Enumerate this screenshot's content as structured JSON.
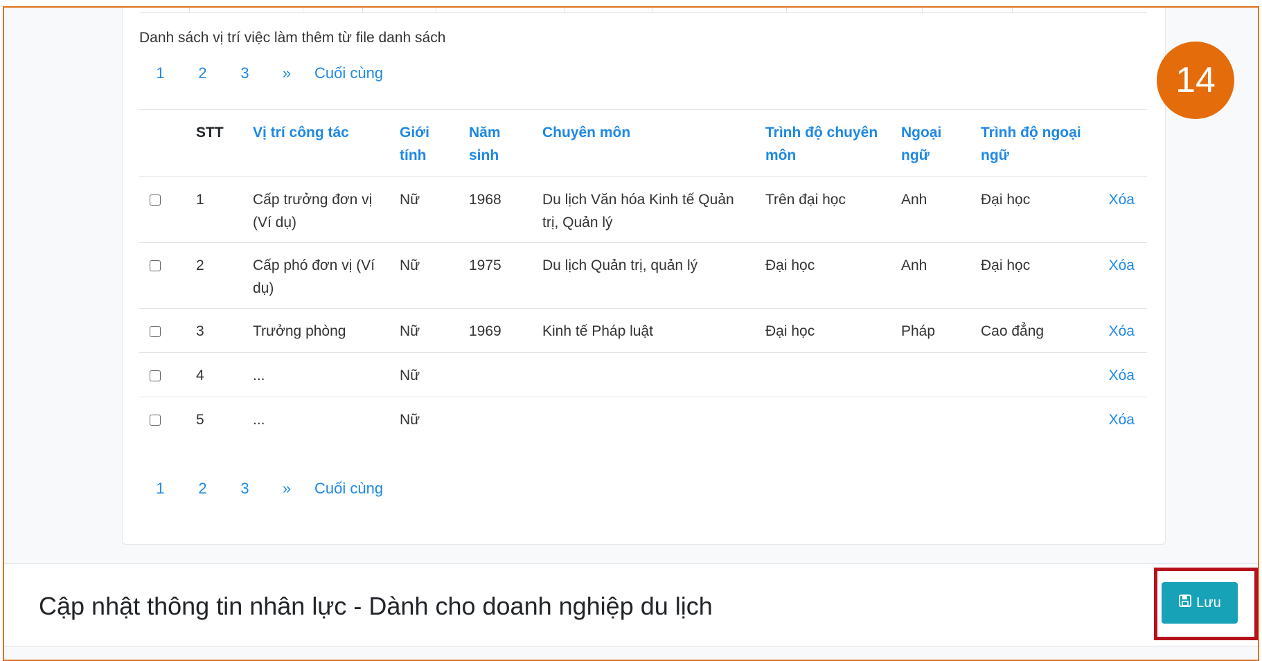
{
  "list_caption": "Danh sách vị trí việc làm thêm từ file danh sách",
  "pagination": {
    "pages": [
      "1",
      "2",
      "3"
    ],
    "next": "»",
    "last": "Cuối cùng"
  },
  "table": {
    "headers": {
      "stt": "STT",
      "position": "Vị trí công tác",
      "gender": "Giới tính",
      "birth_year": "Năm sinh",
      "specialty": "Chuyên môn",
      "qualification": "Trình độ chuyên môn",
      "language": "Ngoại ngữ",
      "language_level": "Trình độ ngoại ngữ"
    },
    "rows": [
      {
        "stt": "1",
        "position": "Cấp trưởng đơn vị (Ví dụ)",
        "gender": "Nữ",
        "birth_year": "1968",
        "specialty": "Du lịch Văn hóa Kinh tế Quản trị, Quản lý",
        "qualification": "Trên đại học",
        "language": "Anh",
        "language_level": "Đại học",
        "action": "Xóa"
      },
      {
        "stt": "2",
        "position": "Cấp phó đơn vị (Ví dụ)",
        "gender": "Nữ",
        "birth_year": "1975",
        "specialty": "Du lịch Quản trị, quản lý",
        "qualification": "Đại học",
        "language": "Anh",
        "language_level": "Đại học",
        "action": "Xóa"
      },
      {
        "stt": "3",
        "position": "Trưởng phòng",
        "gender": "Nữ",
        "birth_year": "1969",
        "specialty": "Kinh tế Pháp luật",
        "qualification": "Đại học",
        "language": "Pháp",
        "language_level": "Cao đẳng",
        "action": "Xóa"
      },
      {
        "stt": "4",
        "position": "...",
        "gender": "Nữ",
        "birth_year": "",
        "specialty": "",
        "qualification": "",
        "language": "",
        "language_level": "",
        "action": "Xóa"
      },
      {
        "stt": "5",
        "position": "...",
        "gender": "Nữ",
        "birth_year": "",
        "specialty": "",
        "qualification": "",
        "language": "",
        "language_level": "",
        "action": "Xóa"
      }
    ]
  },
  "step_badge": "14",
  "footer": {
    "title": "Cập nhật thông tin nhân lực - Dành cho doanh nghiệp du lịch",
    "save_label": "Lưu",
    "save_icon": "floppy-disk-icon"
  },
  "colors": {
    "link": "#1e88e5",
    "badge": "#e46c0a",
    "save_button": "#17a2b8",
    "highlight_border": "#b5121b",
    "frame_border": "#e0701a"
  }
}
